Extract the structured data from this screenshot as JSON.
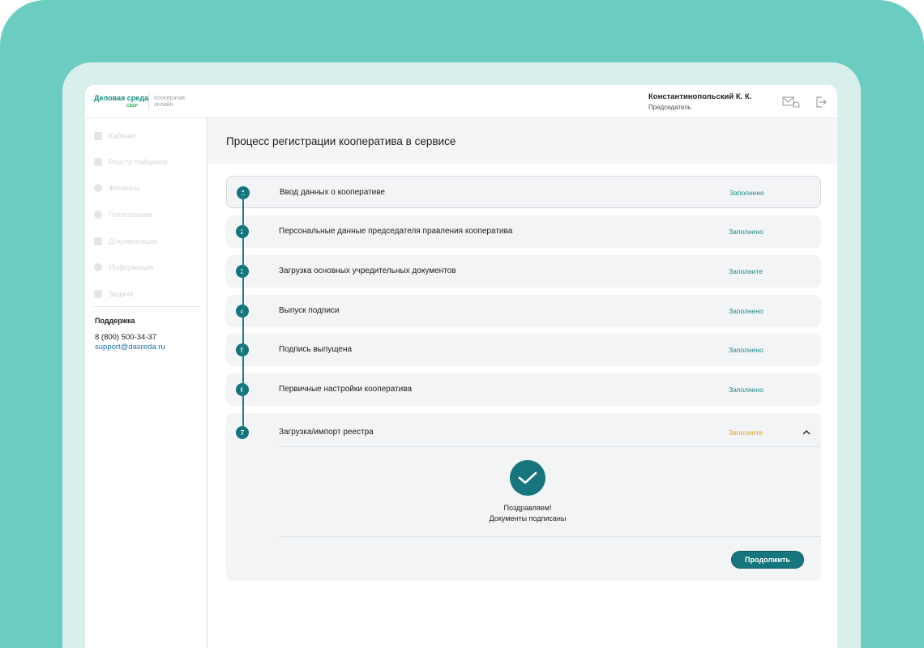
{
  "header": {
    "logo_main": "Деловая среда",
    "logo_sber": "СБЕР",
    "logo_sub": "Кооператив онлайн",
    "user_name": "Константинопольский К. К.",
    "user_role": "Председатель",
    "mail_icon": "mail-bell-icon",
    "logout_icon": "logout-icon"
  },
  "sidebar": {
    "items": [
      {
        "label": "Кабинет",
        "icon": "home-icon"
      },
      {
        "label": "Реестр пайщиков",
        "icon": "grid-icon"
      },
      {
        "label": "Финансы",
        "icon": "coin-icon"
      },
      {
        "label": "Голосование",
        "icon": "check-circle-icon"
      },
      {
        "label": "Документация",
        "icon": "document-icon"
      },
      {
        "label": "Информация",
        "icon": "info-icon"
      },
      {
        "label": "Задачи",
        "icon": "calendar-icon"
      }
    ],
    "support_title": "Поддержка",
    "support_phone": "8 (800) 500-34-37",
    "support_email": "support@dasreda.ru"
  },
  "main": {
    "title": "Процесс регистрации кооператива в сервисе",
    "steps": [
      {
        "num": "1",
        "title": "Ввод данных о кооперативе",
        "status": "Заполнено"
      },
      {
        "num": "2",
        "title": "Персональные данные председателя правления кооператива",
        "status": "Заполнено"
      },
      {
        "num": "3",
        "title": "Загрузка основных учредительных документов",
        "status": "Заполните"
      },
      {
        "num": "4",
        "title": "Выпуск подписи",
        "status": "Заполнено"
      },
      {
        "num": "5",
        "title": "Подпись выпущена",
        "status": "Заполнено"
      },
      {
        "num": "6",
        "title": "Первичные настройки кооператива",
        "status": "Заполнено"
      },
      {
        "num": "7",
        "title": "Загрузка/импорт реестра",
        "status": "Заполните"
      }
    ],
    "congrats_line1": "Поздравляем!",
    "congrats_line2": "Документы подписаны",
    "continue_label": "Продолжить"
  },
  "colors": {
    "accent": "#17767d",
    "status_done": "#1a8a8a",
    "status_pending": "#e0a020",
    "frame": "#6bccc2"
  }
}
